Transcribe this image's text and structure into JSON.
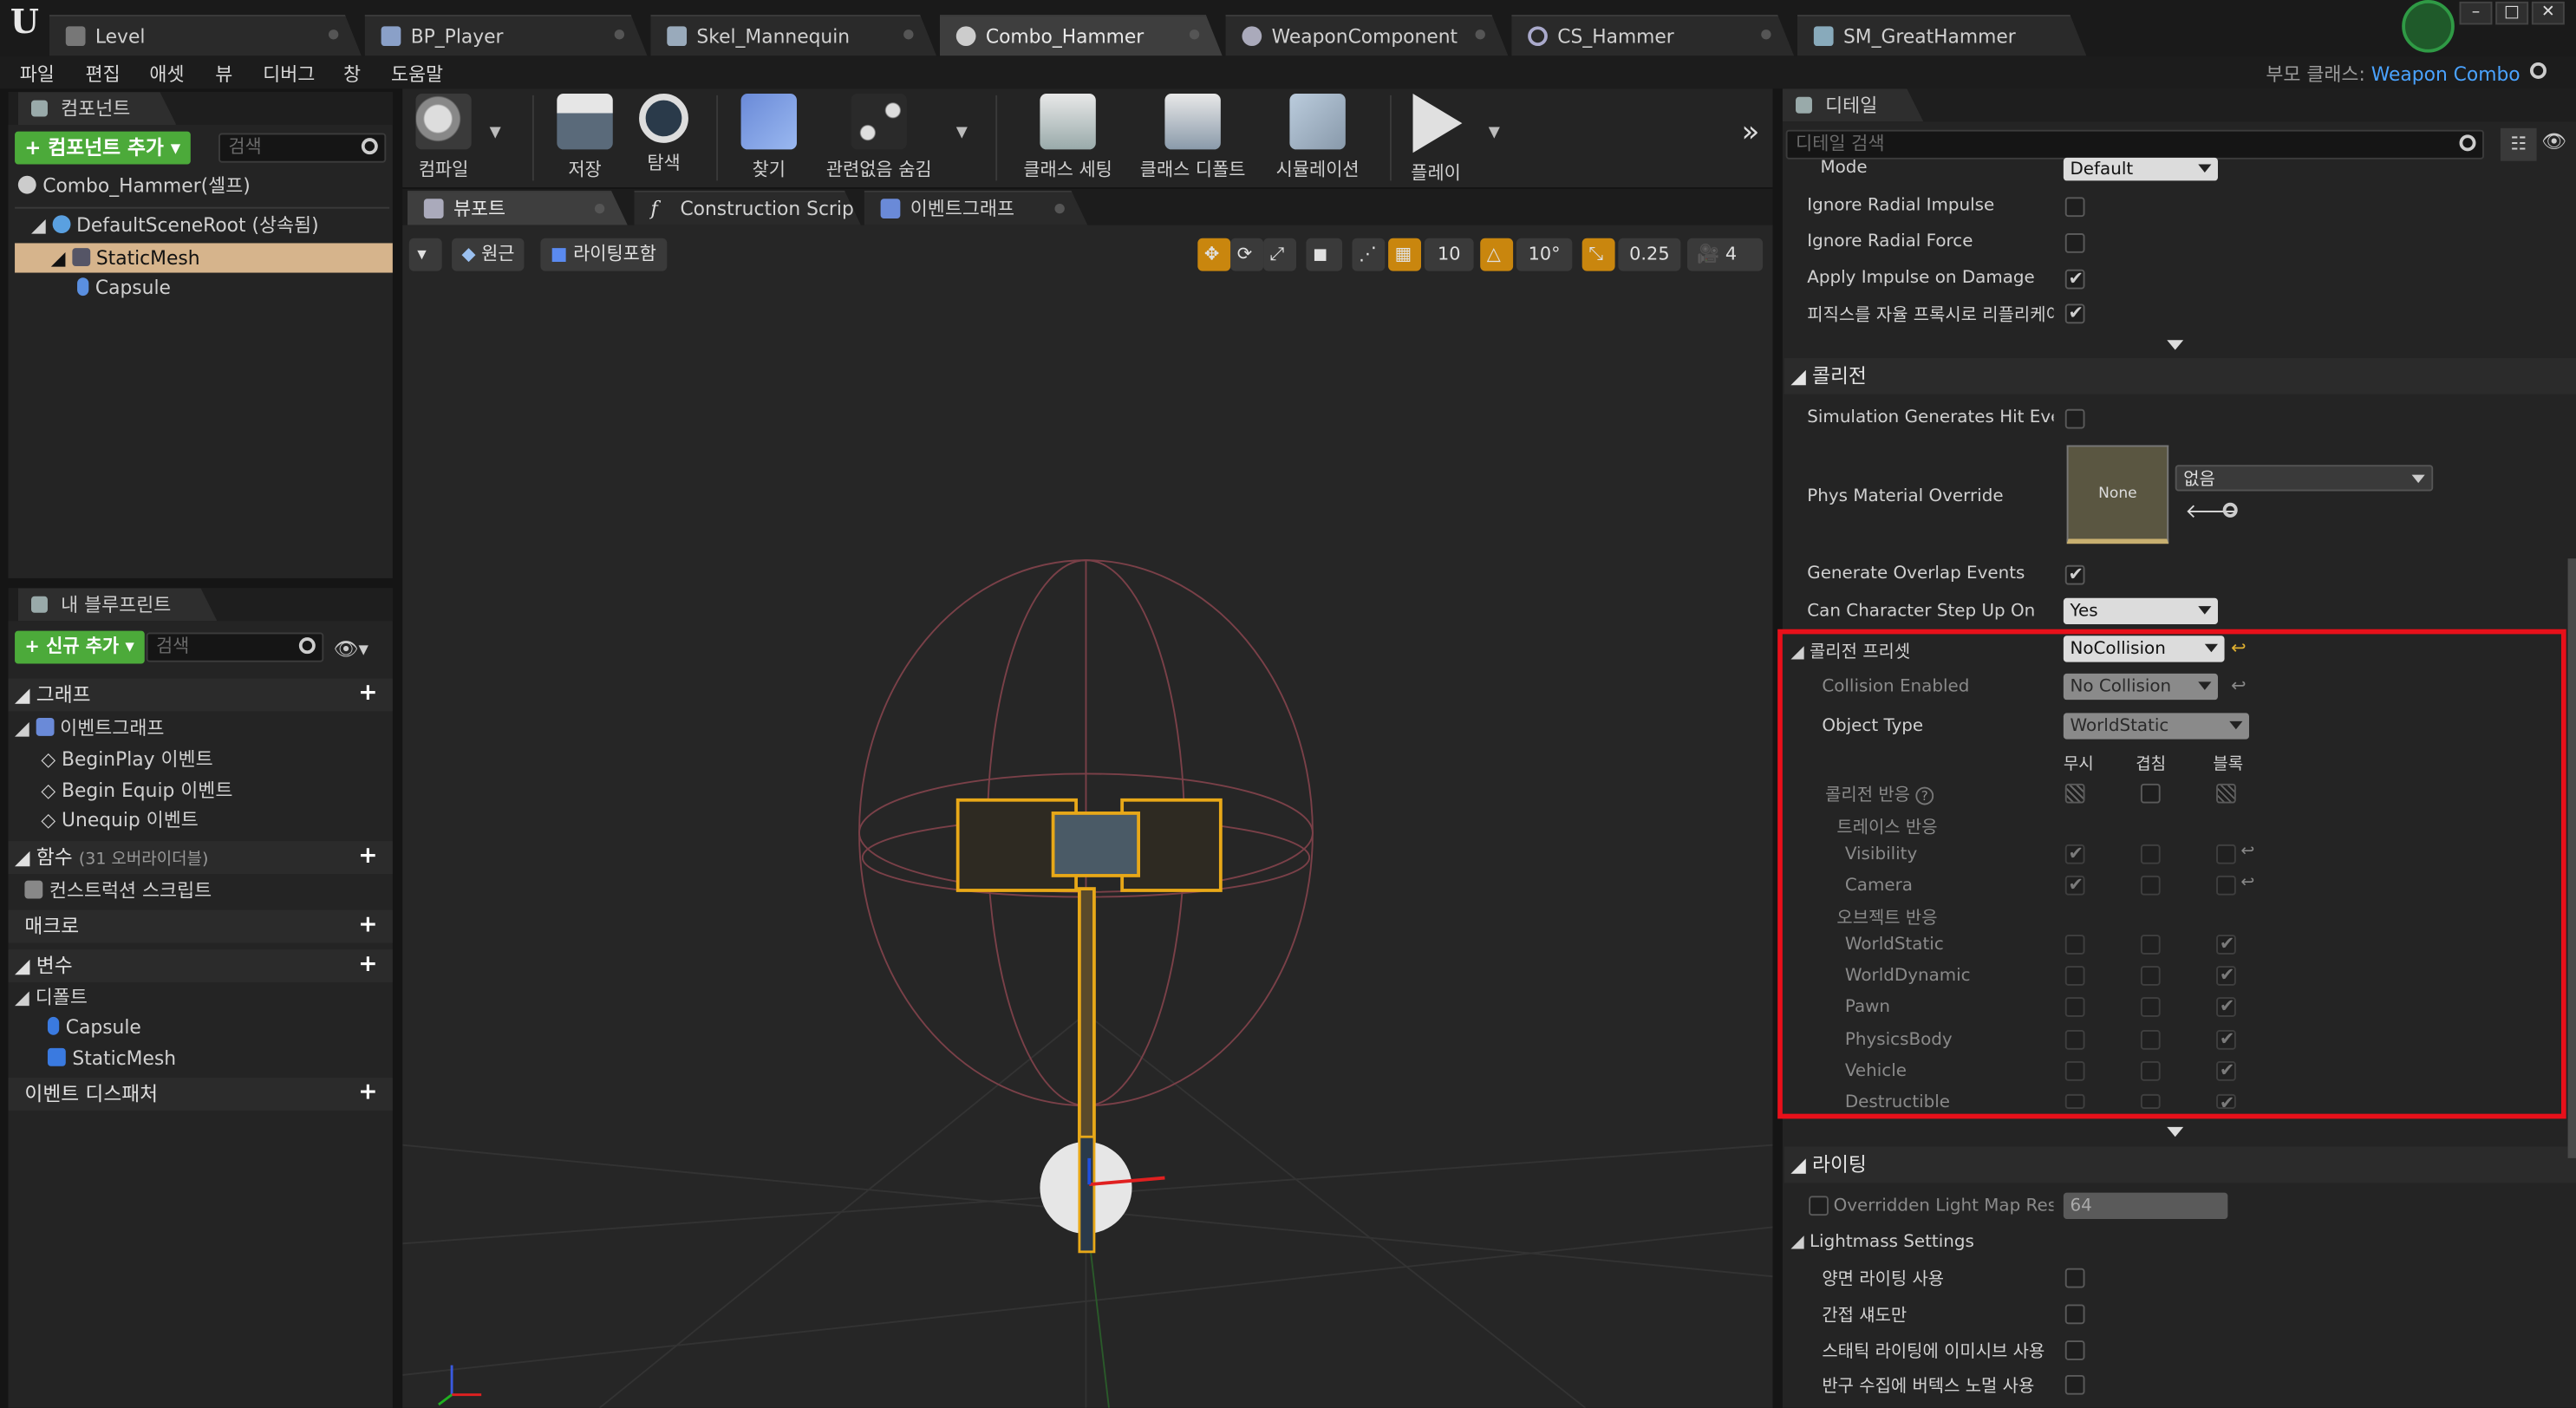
{
  "tabs": [
    {
      "label": "Level",
      "active": false
    },
    {
      "label": "BP_Player",
      "active": false
    },
    {
      "label": "Skel_Mannequin",
      "active": false
    },
    {
      "label": "Combo_Hammer",
      "active": true
    },
    {
      "label": "WeaponComponent",
      "active": false
    },
    {
      "label": "CS_Hammer",
      "active": false
    },
    {
      "label": "SM_GreatHammer",
      "active": false
    }
  ],
  "menu": [
    "파일",
    "편집",
    "애셋",
    "뷰",
    "디버그",
    "창",
    "도움말"
  ],
  "parent_class": {
    "label": "부모 클래스:",
    "value": "Weapon Combo"
  },
  "components": {
    "tab": "컴포넌트",
    "add_button": "+ 컴포넌트 추가 ▾",
    "search_placeholder": "검색",
    "self": "Combo_Hammer(셀프)",
    "tree": [
      "DefaultSceneRoot (상속됨)",
      "StaticMesh",
      "Capsule"
    ]
  },
  "my_blueprint": {
    "tab": "내 블루프린트",
    "add_button": "+ 신규 추가 ▾",
    "search_placeholder": "검색",
    "graph": "그래프",
    "event_graph": "이벤트그래프",
    "events": [
      "BeginPlay 이벤트",
      "Begin Equip 이벤트",
      "Unequip 이벤트"
    ],
    "functions": "함수",
    "functions_count": "(31 오버라이더블)",
    "construction": "컨스트럭션 스크립트",
    "macros": "매크로",
    "variables": "변수",
    "components": "디폴트",
    "component_items": [
      "Capsule",
      "StaticMesh"
    ],
    "dispatchers": "이벤트 디스패처"
  },
  "toolbar": [
    "컴파일",
    "저장",
    "탐색",
    "찾기",
    "관련없음 숨김",
    "클래스 세팅",
    "클래스 디폴트",
    "시뮬레이션",
    "플레이"
  ],
  "editor_tabs": [
    "뷰포트",
    "Construction Scrip",
    "이벤트그래프"
  ],
  "viewport": {
    "perspective": "원근",
    "lighting": "라이팅포함",
    "grid_snap": "10",
    "rot_snap": "10°",
    "scale_snap": "0.25",
    "cam_speed": "4"
  },
  "details": {
    "tab": "디테일",
    "search_placeholder": "디테일 검색",
    "mode_label": "Mode",
    "mode_value": "Default",
    "physics_rows": [
      {
        "label": "Ignore Radial Impulse",
        "checked": false
      },
      {
        "label": "Ignore Radial Force",
        "checked": false
      },
      {
        "label": "Apply Impulse on Damage",
        "checked": true
      },
      {
        "label": "피직스를 자율 프록시로 리플리케이트",
        "checked": true
      }
    ],
    "collision_header": "콜리전",
    "sim_hit": "Simulation Generates Hit Events",
    "phys_mat": "Phys Material Override",
    "phys_mat_thumb": "None",
    "phys_mat_value": "없음",
    "overlap": "Generate Overlap Events",
    "step_up": "Can Character Step Up On",
    "step_up_value": "Yes",
    "preset_label": "콜리전 프리셋",
    "preset_value": "NoCollision",
    "enabled_label": "Collision Enabled",
    "enabled_value": "No Collision",
    "object_type_label": "Object Type",
    "object_type_value": "WorldStatic",
    "response_cols": [
      "무시",
      "겹침",
      "블록"
    ],
    "response_label": "콜리전 반응",
    "trace_label": "트레이스 반응",
    "trace_rows": [
      "Visibility",
      "Camera"
    ],
    "object_label": "오브젝트 반응",
    "object_rows": [
      "WorldStatic",
      "WorldDynamic",
      "Pawn",
      "PhysicsBody",
      "Vehicle",
      "Destructible"
    ],
    "lighting_header": "라이팅",
    "lightmap_label": "Overridden Light Map Res",
    "lightmap_value": "64",
    "lightmass": "Lightmass Settings",
    "lightmass_rows": [
      "양면 라이팅 사용",
      "간접 섀도만",
      "스태틱 라이팅에 이미시브 사용",
      "반구 수집에 버텍스 노멀 사용"
    ]
  },
  "colors": {
    "accent_green": "#4caa3a",
    "highlight": "#e8101a",
    "selection": "#d6b48c",
    "snap_orange": "#c9860e"
  }
}
